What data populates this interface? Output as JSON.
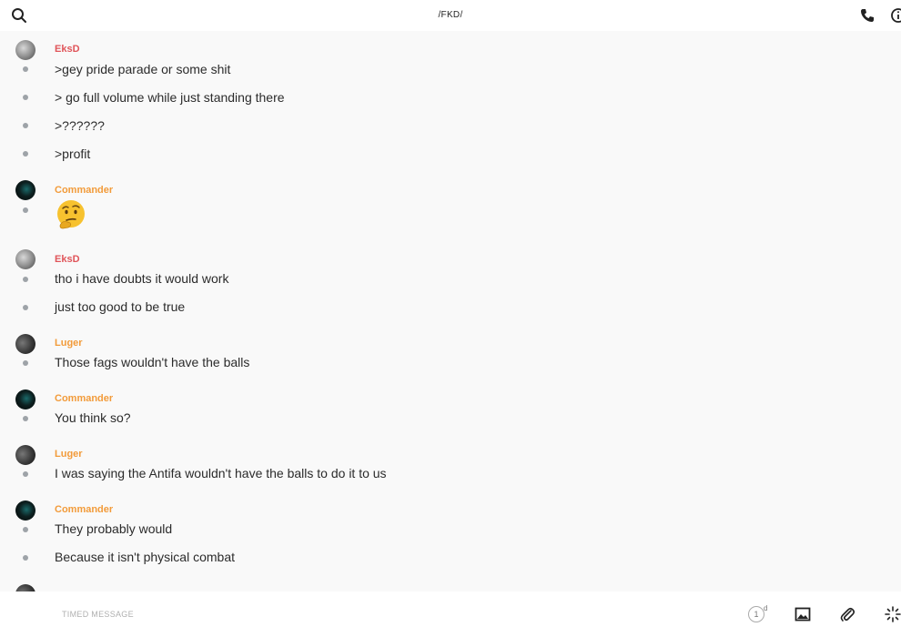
{
  "header": {
    "title": "/FKD/",
    "icons": [
      "search-icon",
      "phone-icon",
      "info-icon"
    ]
  },
  "colors": {
    "eksd": "#e0555a",
    "commander": "#f29b3a",
    "luger": "#f29b3a",
    "dot": "#9ea3a8"
  },
  "groups": [
    {
      "author": "EksD",
      "messages": [
        ">gey pride parade or some shit",
        "> go full volume while just standing there",
        ">??????",
        ">profit"
      ]
    },
    {
      "author": "Commander",
      "messages": [],
      "emoji": "thinking-face"
    },
    {
      "author": "EksD",
      "messages": [
        "tho i have doubts it would work",
        "just too good to be true"
      ]
    },
    {
      "author": "Luger",
      "messages": [
        "Those fags wouldn't have the balls"
      ]
    },
    {
      "author": "Commander",
      "messages": [
        "You think so?"
      ]
    },
    {
      "author": "Luger",
      "messages": [
        "I was saying the Antifa wouldn't have the balls to do it to us"
      ]
    },
    {
      "author": "Commander",
      "messages": [
        "They probably would",
        "Because it isn't physical combat"
      ]
    }
  ],
  "footer": {
    "placeholder": "TIMED MESSAGE",
    "timer_value": "1",
    "timer_unit": "d",
    "icons": [
      "timer-icon",
      "image-icon",
      "attachment-icon",
      "sparkle-icon"
    ]
  }
}
